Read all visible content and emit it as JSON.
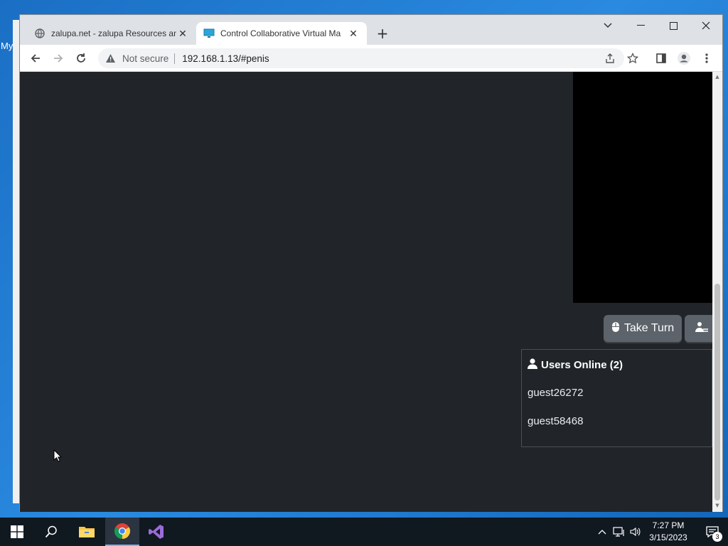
{
  "desktop": {
    "icon_label": "My"
  },
  "browser": {
    "tabs": [
      {
        "title": "zalupa.net - zalupa Resources an",
        "favicon": "globe-icon",
        "active": false
      },
      {
        "title": "Control Collaborative Virtual Ma",
        "favicon": "monitor-icon",
        "active": true
      }
    ],
    "address": {
      "security_label": "Not secure",
      "url": "192.168.1.13/#penis"
    }
  },
  "page": {
    "take_turn_label": "Take Turn",
    "users": {
      "title": "Users Online (2)",
      "list": [
        "guest26272",
        "guest58468"
      ]
    }
  },
  "taskbar": {
    "time": "7:27 PM",
    "date": "3/15/2023",
    "notification_count": "3"
  },
  "colors": {
    "page_bg": "#212529",
    "button_bg": "#5c636a",
    "taskbar_bg": "#101820"
  }
}
